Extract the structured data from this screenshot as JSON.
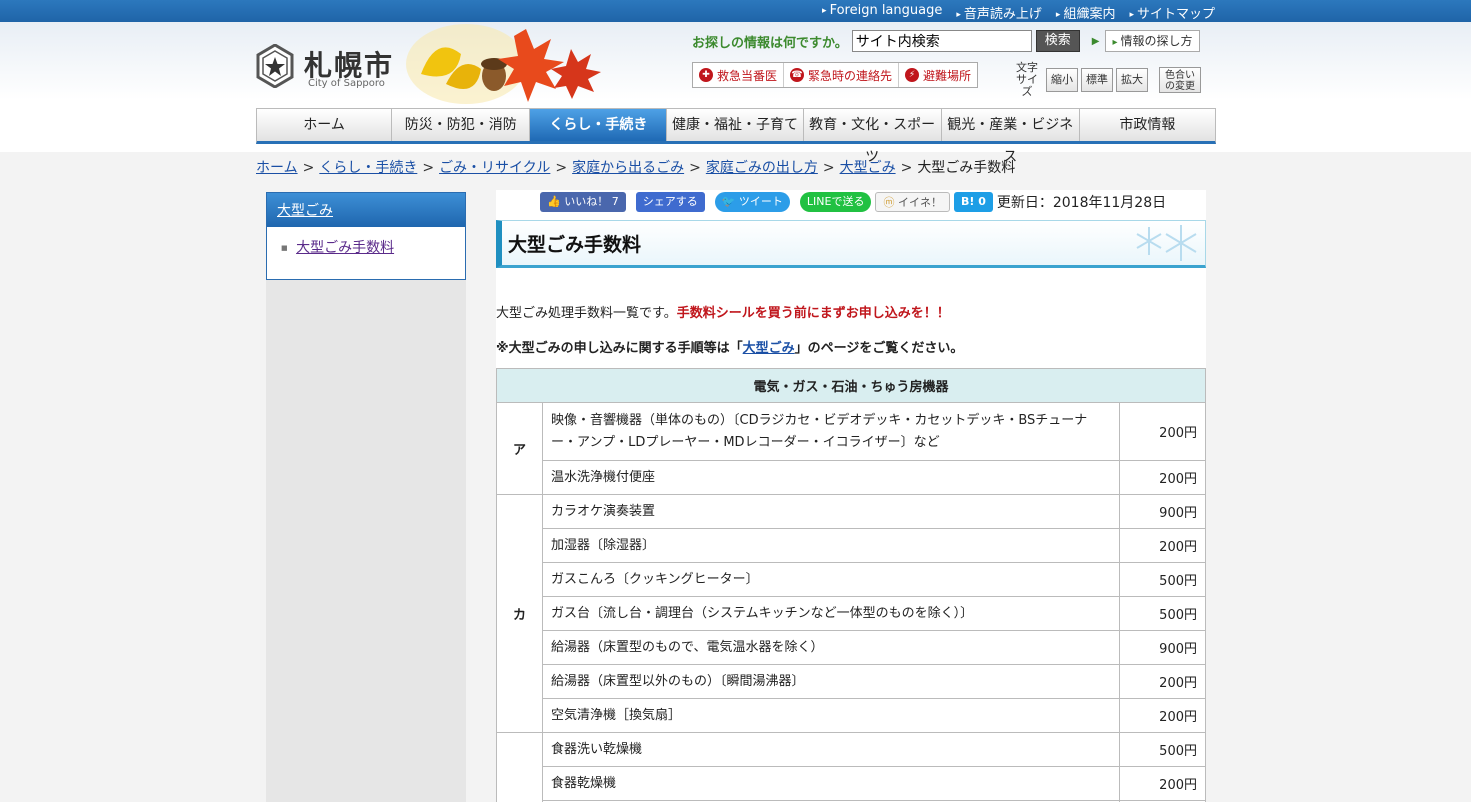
{
  "topbar": {
    "links": [
      "Foreign language",
      "音声読み上げ",
      "組織案内",
      "サイトマップ"
    ]
  },
  "logo": {
    "city_jp": "札幌市",
    "city_en": "City of Sapporo"
  },
  "search": {
    "question": "お探しの情報は何ですか。",
    "input_value": "サイト内検索",
    "button": "検索",
    "find_info": "情報の探し方"
  },
  "emergency": [
    "救急当番医",
    "緊急時の連絡先",
    "避難場所"
  ],
  "text_size": {
    "label_line1": "文字",
    "label_line2": "サイズ",
    "buttons": [
      "縮小",
      "標準",
      "拡大"
    ],
    "color_line1": "色合い",
    "color_line2": "の変更"
  },
  "global_nav": [
    "ホーム",
    "防災・防犯・消防",
    "くらし・手続き",
    "健康・福祉・子育て",
    "教育・文化・スポーツ",
    "観光・産業・ビジネス",
    "市政情報"
  ],
  "breadcrumb": [
    "ホーム",
    "くらし・手続き",
    "ごみ・リサイクル",
    "家庭から出るごみ",
    "家庭ごみの出し方",
    "大型ごみ"
  ],
  "breadcrumb_current": "大型ごみ手数料",
  "sidebar": {
    "heading": "大型ごみ",
    "item": "大型ごみ手数料"
  },
  "social": {
    "like": "いいね！ 7",
    "share": "シェアする",
    "tweet": "ツイート",
    "line": "LINEで送る",
    "mixi": "イイネ！",
    "hatena": "B! 0"
  },
  "updated": "更新日：2018年11月28日",
  "page_title": "大型ごみ手数料",
  "intro_normal": "大型ごみ処理手数料一覧です。",
  "intro_red": "手数料シールを買う前にまずお申し込みを！！",
  "note_pre": "※大型ごみの申し込みに関する手順等は「",
  "note_link": "大型ごみ",
  "note_post": "」のページをご覧ください。",
  "table": {
    "category": "電気・ガス・石油・ちゅう房機器",
    "rows": [
      {
        "kana": "ア",
        "item": "映像・音響機器（単体のもの）〔CDラジカセ・ビデオデッキ・カセットデッキ・BSチューナー・アンプ・LDプレーヤー・MDレコーダー・イコライザー〕など",
        "price": "200円"
      },
      {
        "kana": "",
        "item": "温水洗浄機付便座",
        "price": "200円"
      },
      {
        "kana": "カ",
        "item": "カラオケ演奏装置",
        "price": "900円"
      },
      {
        "kana": "",
        "item": "加湿器〔除湿器〕",
        "price": "200円"
      },
      {
        "kana": "",
        "item": "ガスこんろ〔クッキングヒーター〕",
        "price": "500円"
      },
      {
        "kana": "",
        "item": "ガス台〔流し台・調理台（システムキッチンなど一体型のものを除く）〕",
        "price": "500円"
      },
      {
        "kana": "",
        "item": "給湯器（床置型のもので、電気温水器を除く）",
        "price": "900円"
      },
      {
        "kana": "",
        "item": "給湯器（床置型以外のもの）〔瞬間湯沸器〕",
        "price": "200円"
      },
      {
        "kana": "",
        "item": "空気清浄機［換気扇］",
        "price": "200円"
      },
      {
        "kana": "",
        "item": "食器洗い乾燥機",
        "price": "500円"
      },
      {
        "kana": "",
        "item": "食器乾燥機",
        "price": "200円"
      }
    ]
  }
}
